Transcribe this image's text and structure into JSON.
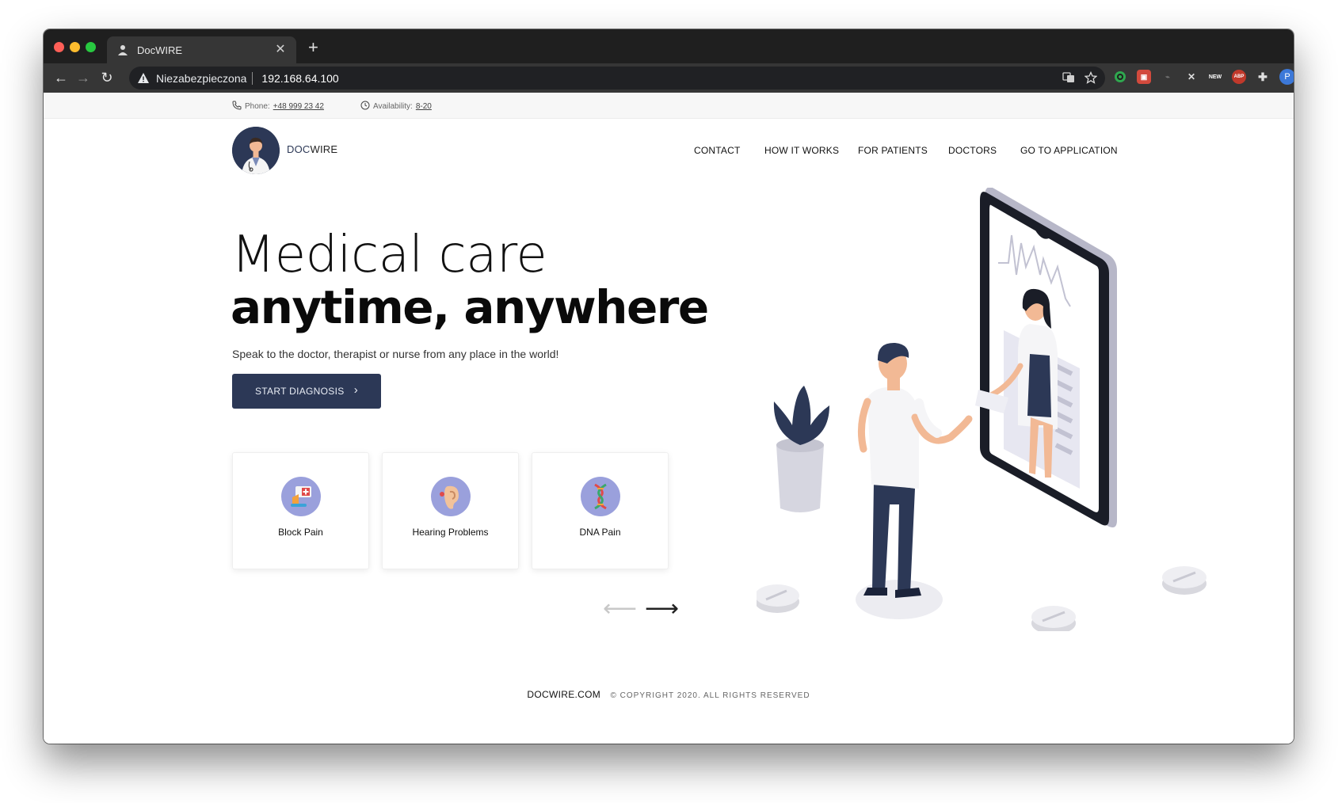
{
  "browser": {
    "tab_title": "DocWIRE",
    "security_label": "Niezabezpieczona",
    "url": "192.168.64.100",
    "profile_initial": "P"
  },
  "topbar": {
    "phone_label": "Phone:",
    "phone_value": "+48 999 23 42",
    "availability_label": "Availability:",
    "availability_value": "8-20"
  },
  "brand": {
    "name_part1": "DOC",
    "name_part2": "WIRE"
  },
  "nav": {
    "items": [
      "CONTACT",
      "HOW IT WORKS",
      "FOR PATIENTS",
      "DOCTORS",
      "GO TO APPLICATION"
    ]
  },
  "hero": {
    "line1": "Medical care",
    "line2": "anytime, anywhere",
    "subtitle": "Speak to the doctor, therapist or nurse from any place in the world!",
    "cta_label": "START DIAGNOSIS"
  },
  "cards": [
    {
      "label": "Block Pain",
      "icon": "first-aid-icon"
    },
    {
      "label": "Hearing Problems",
      "icon": "ear-icon"
    },
    {
      "label": "DNA Pain",
      "icon": "dna-icon"
    }
  ],
  "footer": {
    "site": "DOCWIRE.COM",
    "copyright": "© COPYRIGHT 2020. ALL RIGHTS RESERVED"
  },
  "colors": {
    "brand_navy": "#2c3856",
    "accent_lavender": "#9aa0dc"
  }
}
